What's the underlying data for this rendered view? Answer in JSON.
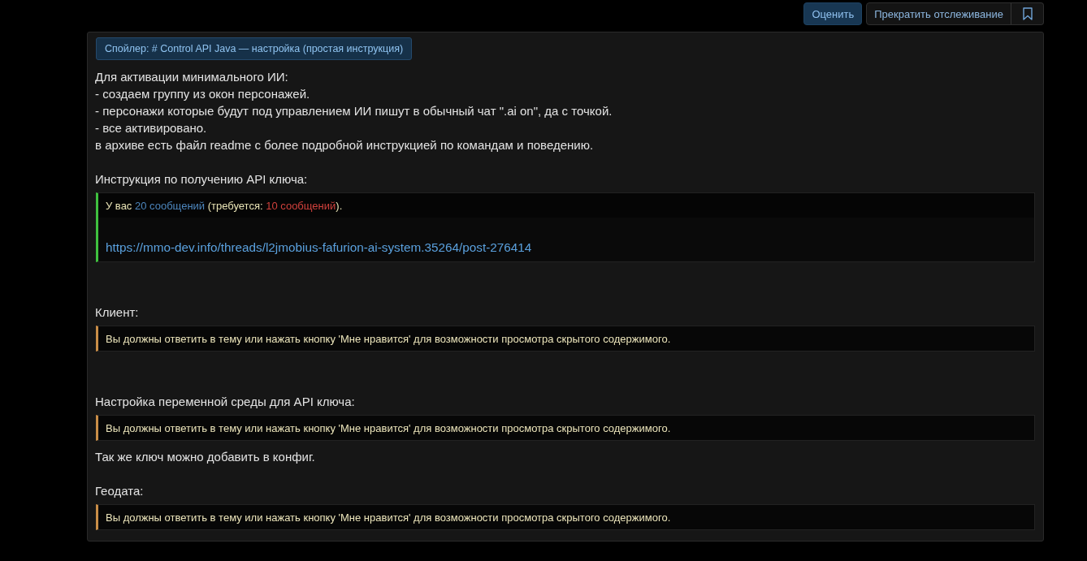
{
  "thread_actions": {
    "rate_button": {
      "label": "Оценить"
    },
    "watch_button": {
      "label": "Прекратить отслеживание"
    },
    "bookmark_button": {
      "bookmarked": false
    }
  },
  "post": {
    "spoiler": {
      "label": "Спойлер: # Control API Java — настройка (простая инструкция)"
    },
    "content": [
      {
        "kind": "text",
        "lines": [
          "Для активации минимального ИИ:",
          "- создаем группу из окон персонажей.",
          "- персонажи которые будут под управлением ИИ пишут в обычный чат \".ai on\", да с точкой.",
          "- все активировано.",
          "в архиве есть файл readme с более подробной инструкцией по командам и поведению."
        ]
      },
      {
        "kind": "blank"
      },
      {
        "kind": "text",
        "lines": [
          "Инструкция по получению API ключа:"
        ]
      },
      {
        "kind": "unlocked",
        "notice": [
          {
            "kind": "plain",
            "text": "У вас "
          },
          {
            "kind": "have",
            "text": "20 сообщений"
          },
          {
            "kind": "plain",
            "text": " (требуется: "
          },
          {
            "kind": "need",
            "text": "10 сообщений"
          },
          {
            "kind": "plain",
            "text": ")."
          }
        ],
        "link": "https://mmo-dev.info/threads/l2jmobius-fafurion-ai-system.35264/post-276414"
      },
      {
        "kind": "blank"
      },
      {
        "kind": "blank"
      },
      {
        "kind": "text",
        "lines": [
          "Клиент:"
        ]
      },
      {
        "kind": "locked",
        "message": "Вы должны ответить в тему или нажать кнопку 'Мне нравится' для возможности просмотра скрытого содержимого."
      },
      {
        "kind": "blank"
      },
      {
        "kind": "blank"
      },
      {
        "kind": "text",
        "lines": [
          "Настройка переменной среды для API ключа:"
        ]
      },
      {
        "kind": "locked",
        "message": "Вы должны ответить в тему или нажать кнопку 'Мне нравится' для возможности просмотра скрытого содержимого."
      },
      {
        "kind": "text",
        "lines": [
          "Так же ключ можно добавить в конфиг."
        ]
      },
      {
        "kind": "blank"
      },
      {
        "kind": "text",
        "lines": [
          "Геодата:"
        ]
      },
      {
        "kind": "locked",
        "message": "Вы должны ответить в тему или нажать кнопку 'Мне нравится' для возможности просмотра скрытого содержимого."
      }
    ]
  }
}
